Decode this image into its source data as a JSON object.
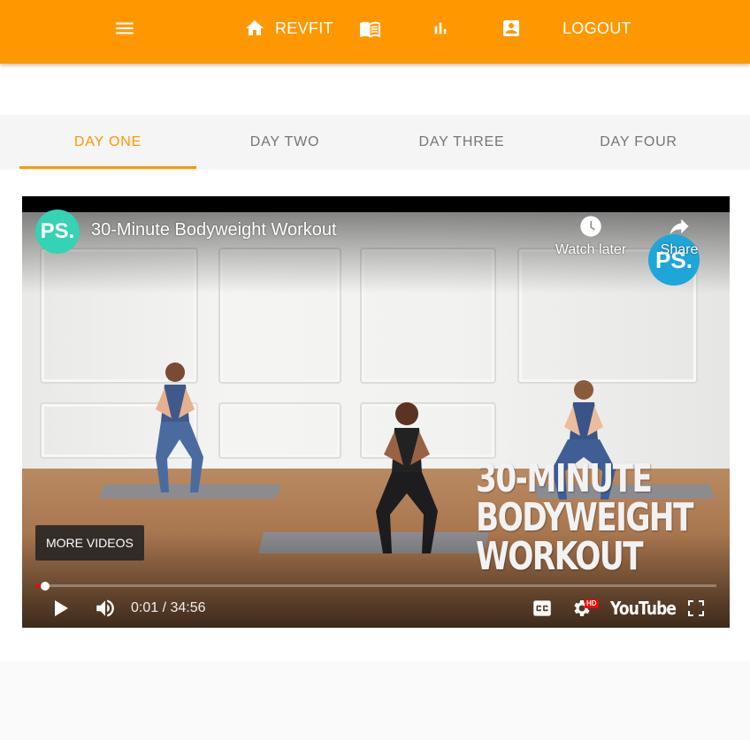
{
  "appbar": {
    "brand_label": "REVFIT",
    "logout_label": "LOGOUT",
    "icons": [
      "menu-icon",
      "home-icon",
      "book-icon",
      "bar-chart-icon",
      "account-box-icon"
    ],
    "color": "#ff9800"
  },
  "tabs": [
    {
      "label": "DAY ONE",
      "active": true
    },
    {
      "label": "DAY TWO",
      "active": false
    },
    {
      "label": "DAY THREE",
      "active": false
    },
    {
      "label": "DAY FOUR",
      "active": false
    }
  ],
  "video": {
    "title": "30-Minute Bodyweight Workout",
    "channel_logo": "PS.",
    "watch_later_label": "Watch later",
    "share_label": "Share",
    "overlay_lines": [
      "30-MINUTE",
      "BODYWEIGHT",
      "WORKOUT"
    ],
    "more_videos_label": "MORE VIDEOS",
    "time_display": "0:01 / 34:56",
    "progress_fraction": 0.0005,
    "platform_label": "YouTube",
    "hd_badge": "HD",
    "accent": "#ff0000"
  }
}
